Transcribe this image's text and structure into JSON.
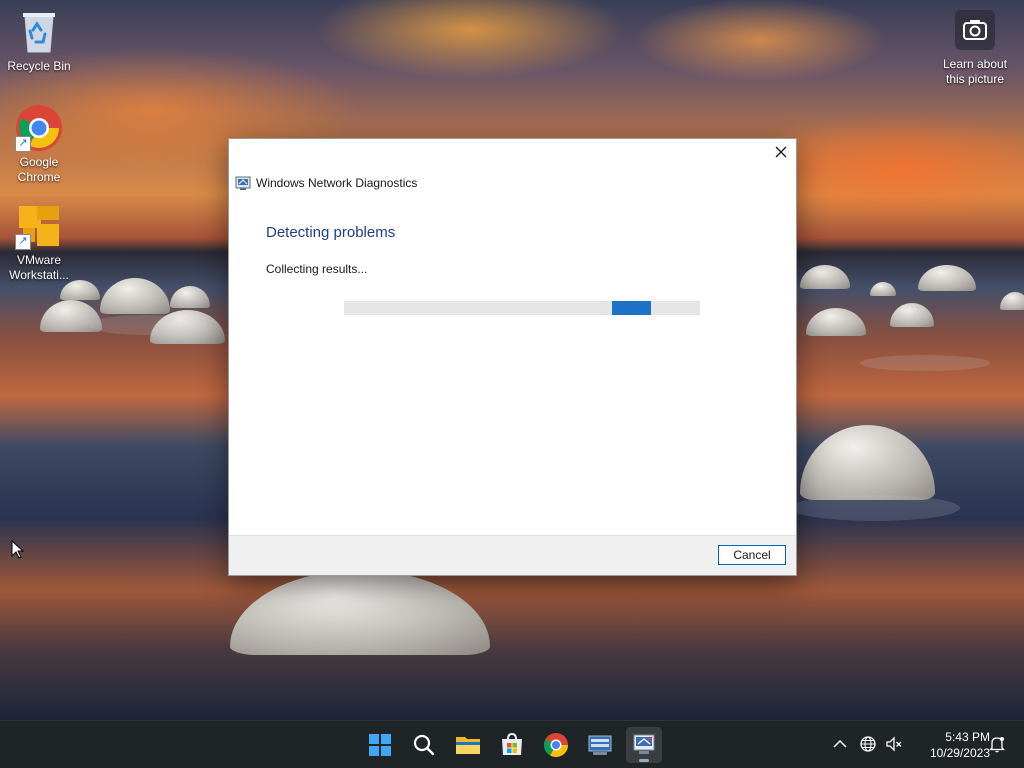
{
  "desktop": {
    "icons": [
      {
        "label": "Recycle Bin"
      },
      {
        "label": "Google Chrome"
      },
      {
        "label": "VMware Workstati..."
      }
    ],
    "learn_about": "Learn about this picture"
  },
  "dialog": {
    "title": "Windows Network Diagnostics",
    "heading": "Detecting problems",
    "status": "Collecting results...",
    "cancel_label": "Cancel",
    "close_glyph": "✕",
    "progress_state": "indeterminate",
    "accent_color": "#1e73c8",
    "heading_color": "#1e3d8f"
  },
  "taskbar": {
    "apps": [
      "start-icon",
      "search-icon",
      "file-explorer-icon",
      "microsoft-store-icon",
      "chrome-icon",
      "on-screen-keyboard-icon",
      "network-diagnostics-icon"
    ],
    "active_app": "network-diagnostics-icon",
    "tray": [
      "chevron-up-icon",
      "globe-network-icon",
      "speaker-muted-icon",
      "notification-bell-icon"
    ],
    "time": "5:43 PM",
    "date": "10/29/2023"
  }
}
